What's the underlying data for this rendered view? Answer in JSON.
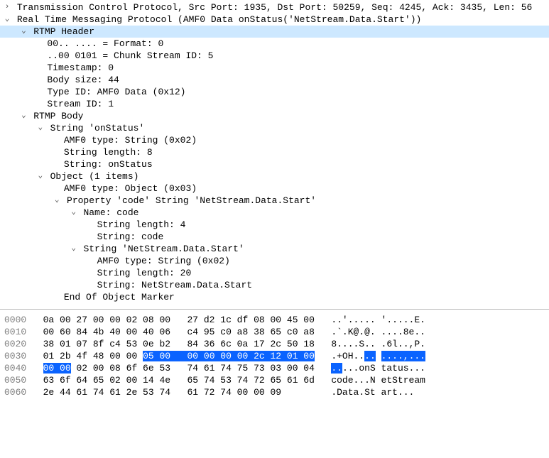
{
  "tree": {
    "tcp": "Transmission Control Protocol, Src Port: 1935, Dst Port: 50259, Seq: 4245, Ack: 3435, Len: 56",
    "rtmp": "Real Time Messaging Protocol (AMF0 Data onStatus('NetStream.Data.Start'))",
    "header": {
      "label": "RTMP Header",
      "format": "00.. .... = Format: 0",
      "csid": "..00 0101 = Chunk Stream ID: 5",
      "timestamp": "Timestamp: 0",
      "body": "Body size: 44",
      "typeid": "Type ID: AMF0 Data (0x12)",
      "stream": "Stream ID: 1"
    },
    "body": {
      "label": "RTMP Body",
      "str": {
        "label": "String 'onStatus'",
        "amf": "AMF0 type: String (0x02)",
        "len": "String length: 8",
        "val": "String: onStatus"
      },
      "obj": {
        "label": "Object (1 items)",
        "amf": "AMF0 type: Object (0x03)",
        "prop": {
          "label": "Property 'code' String 'NetStream.Data.Start'",
          "name": {
            "label": "Name: code",
            "len": "String length: 4",
            "val": "String: code"
          },
          "str": {
            "label": "String 'NetStream.Data.Start'",
            "amf": "AMF0 type: String (0x02)",
            "len": "String length: 20",
            "val": "String: NetStream.Data.Start"
          }
        },
        "end": "End Of Object Marker"
      }
    }
  },
  "hex": {
    "rows": [
      {
        "off": "0000",
        "p1": "0a 00 27 00 00 02 08 00",
        "p2": "27 d2 1c df 08 00 45 00",
        "a1": "..'..... ",
        "a2": "'.....E."
      },
      {
        "off": "0010",
        "p1": "00 60 84 4b 40 00 40 06",
        "p2": "c4 95 c0 a8 38 65 c0 a8",
        "a1": ".`.K@.@. ",
        "a2": "....8e.."
      },
      {
        "off": "0020",
        "p1": "38 01 07 8f c4 53 0e b2",
        "p2": "84 36 6c 0a 17 2c 50 18",
        "a1": "8....S.. ",
        "a2": ".6l..,P."
      },
      {
        "off": "0030",
        "p1a": "01 2b 4f 48 00 00 ",
        "p1b": "05 00",
        "p2": "00 00 00 00 2c 12 01 00",
        "a1a": ".+OH..",
        "a1b": "..",
        "a1c": " ",
        "a2": "....,..."
      },
      {
        "off": "0040",
        "p1a": "00 00",
        "p1b": " 02 00 08 6f 6e 53",
        "p2": "74 61 74 75 73 03 00 04",
        "a1a": "..",
        "a1b": "...onS ",
        "a2": "tatus..."
      },
      {
        "off": "0050",
        "p1": "63 6f 64 65 02 00 14 4e",
        "p2": "65 74 53 74 72 65 61 6d",
        "a1": "code...N ",
        "a2": "etStream"
      },
      {
        "off": "0060",
        "p1": "2e 44 61 74 61 2e 53 74",
        "p2": "61 72 74 00 00 09",
        "a1": ".Data.St ",
        "a2": "art..."
      }
    ]
  }
}
